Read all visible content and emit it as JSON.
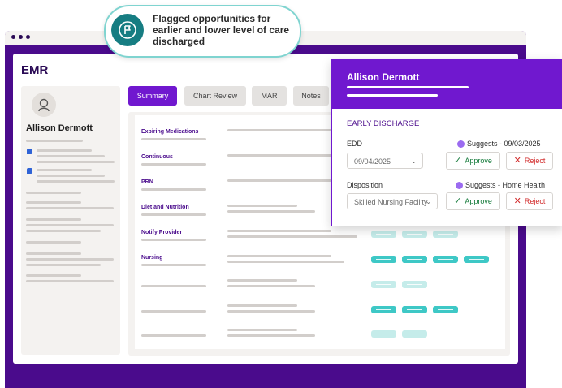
{
  "callout": {
    "text": "Flagged opportunities for earlier and lower level of care discharged",
    "icon": "flag-icon"
  },
  "app": {
    "title": "EMR"
  },
  "patient": {
    "name": "Allison Dermott"
  },
  "tabs": [
    {
      "label": "Summary",
      "active": true
    },
    {
      "label": "Chart Review"
    },
    {
      "label": "MAR"
    },
    {
      "label": "Notes"
    }
  ],
  "summary_rows": [
    {
      "label": "Expiring Medications"
    },
    {
      "label": "Continuous"
    },
    {
      "label": "PRN"
    },
    {
      "label": "Diet and Nutrition"
    },
    {
      "label": "Notify Provider"
    },
    {
      "label": "Nursing"
    }
  ],
  "popup": {
    "patient_name": "Allison Dermott",
    "section_title": "EARLY DISCHARGE",
    "edd": {
      "label": "EDD",
      "value": "09/04/2025",
      "suggestion": "Suggests - 09/03/2025",
      "approve_label": "Approve",
      "reject_label": "Reject"
    },
    "disposition": {
      "label": "Disposition",
      "value": "Skilled Nursing Facility",
      "suggestion": "Suggests - Home Health",
      "approve_label": "Approve",
      "reject_label": "Reject"
    }
  },
  "colors": {
    "brand_purple": "#7018cf",
    "dark_purple": "#4a0b8c",
    "teal": "#3ec8c6",
    "approve_green": "#147a3a",
    "reject_red": "#d22a2a"
  }
}
